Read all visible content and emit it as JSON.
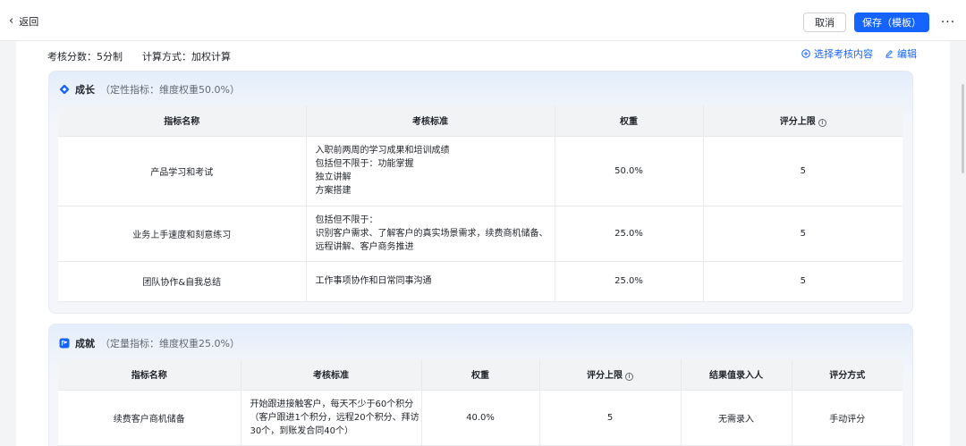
{
  "topbar": {
    "back_label": "返回",
    "cancel_label": "取消",
    "save_label": "保存（模板）",
    "more_label": "···"
  },
  "summary": {
    "score": "考核分数：5分制",
    "method": "计算方式：加权计算"
  },
  "actions": {
    "select_label": "选择考核内容",
    "edit_label": "编辑"
  },
  "sections": [
    {
      "title": "成长",
      "subtitle": "（定性指标：维度权重50.0%）",
      "headers": [
        "指标名称",
        "考核标准",
        "权重",
        "评分上限"
      ],
      "rows": [
        {
          "name": "产品学习和考试",
          "standard": [
            "入职前两周的学习成果和培训成绩",
            "包括但不限于：功能掌握",
            "独立讲解",
            "方案搭建"
          ],
          "weight": "50.0%",
          "limit": "5"
        },
        {
          "name": "业务上手速度和刻意练习",
          "standard": [
            "包括但不限于：",
            "识别客户需求、了解客户的真实场景需求，续费商机储备、",
            "远程讲解、客户商务推进"
          ],
          "weight": "25.0%",
          "limit": "5"
        },
        {
          "name": "团队协作&自我总结",
          "standard": [
            "工作事项协作和日常同事沟通"
          ],
          "weight": "25.0%",
          "limit": "5"
        }
      ]
    },
    {
      "title": "成就",
      "subtitle": "（定量指标：维度权重25.0%）",
      "headers": [
        "指标名称",
        "考核标准",
        "权重",
        "评分上限",
        "结果值录入人",
        "评分方式"
      ],
      "rows": [
        {
          "name": "续费客户商机储备",
          "standard": [
            "开始跟进接触客户，每天不少于60个积分",
            "（客户跟进1个积分，远程20个积分、拜访",
            "30个，到账发合同40个）"
          ],
          "weight": "40.0%",
          "limit": "5",
          "entry": "无需录入",
          "scoring": "手动评分"
        }
      ]
    }
  ],
  "colors": {
    "primary": "#1664ff",
    "header_bg": "#f2f3f5"
  }
}
